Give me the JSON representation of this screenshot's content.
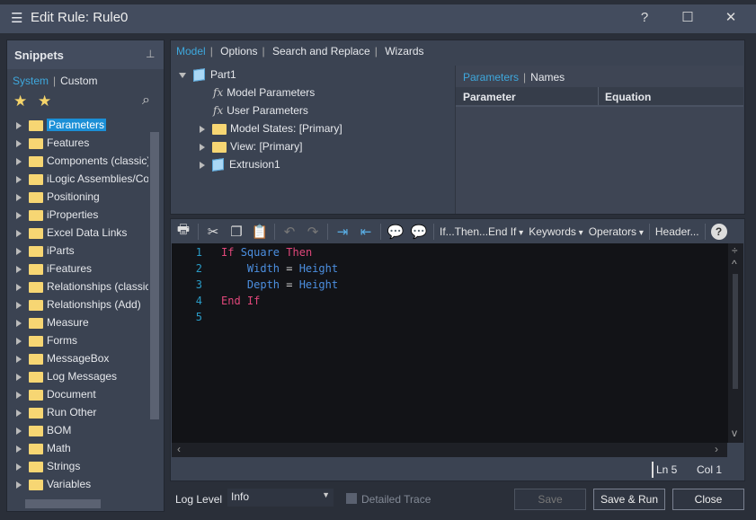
{
  "window": {
    "title": "Edit Rule: Rule0",
    "help_icon": "?",
    "maximize_icon": "☐",
    "close_icon": "✕"
  },
  "snippets": {
    "title": "Snippets",
    "pin_icon": "pin",
    "tabs": [
      {
        "label": "System",
        "active": true
      },
      {
        "label": "Custom",
        "active": false
      }
    ],
    "items": [
      "Parameters",
      "Features",
      "Components (classic)",
      "iLogic Assemblies/Comp",
      "Positioning",
      "iProperties",
      "Excel Data Links",
      "iParts",
      "iFeatures",
      "Relationships (classic)",
      "Relationships (Add)",
      "Measure",
      "Forms",
      "MessageBox",
      "Log Messages",
      "Document",
      "Run Other",
      "BOM",
      "Math",
      "Strings",
      "Variables"
    ],
    "selected": "Parameters"
  },
  "top_tabs": [
    "Model",
    "Options",
    "Search and Replace",
    "Wizards"
  ],
  "model_tree": {
    "root": "Part1",
    "children": [
      "Model Parameters",
      "User Parameters",
      "Model States: [Primary]",
      "View: [Primary]",
      "Extrusion1"
    ]
  },
  "params_panel": {
    "tabs": [
      "Parameters",
      "Names"
    ],
    "columns": [
      "Parameter",
      "Equation"
    ]
  },
  "toolbar": {
    "dropdowns": [
      "If...Then...End If",
      "Keywords",
      "Operators"
    ],
    "header": "Header...",
    "help": "?"
  },
  "code": {
    "lines": [
      [
        {
          "t": "If ",
          "c": "kw"
        },
        {
          "t": "Square ",
          "c": "id"
        },
        {
          "t": "Then",
          "c": "kw"
        }
      ],
      [
        {
          "t": "    Width ",
          "c": "id"
        },
        {
          "t": "= ",
          "c": "op"
        },
        {
          "t": "Height",
          "c": "id"
        }
      ],
      [
        {
          "t": "    Depth ",
          "c": "id"
        },
        {
          "t": "= ",
          "c": "op"
        },
        {
          "t": "Height",
          "c": "id"
        }
      ],
      [
        {
          "t": "End If",
          "c": "kw"
        }
      ],
      []
    ]
  },
  "status": {
    "ln": "Ln 5",
    "col": "Col 1"
  },
  "bottom": {
    "log_level_label": "Log Level",
    "log_level_value": "Info",
    "detailed_trace": "Detailed Trace",
    "save": "Save",
    "save_run": "Save & Run",
    "close": "Close"
  },
  "colors": {
    "accent": "#3ea8dd",
    "keyword": "#e0477a",
    "identifier": "#4c8fe0",
    "selection": "#1b8fd6"
  }
}
